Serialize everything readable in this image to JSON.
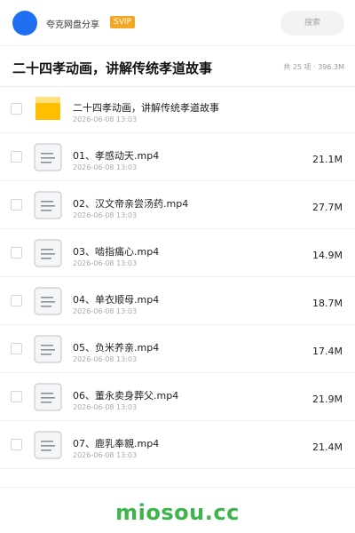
{
  "header": {
    "brand": "夸克网盘分享",
    "badge": "SVIP",
    "search_placeholder": "搜索"
  },
  "folder": {
    "title": "二十四孝动画，讲解传统孝道故事",
    "meta": "共 25 项 · 396.3M"
  },
  "items": [
    {
      "name": "二十四孝动画，讲解传统孝道故事",
      "date": "2026-06-08 13:03",
      "size": "",
      "icon": "folder-icon"
    },
    {
      "name": "01、孝感动天.mp4",
      "date": "2026-06-08 13:03",
      "size": "21.1M",
      "icon": "file-icon"
    },
    {
      "name": "02、汉文帝亲尝汤药.mp4",
      "date": "2026-06-08 13:03",
      "size": "27.7M",
      "icon": "file-icon"
    },
    {
      "name": "03、啮指痛心.mp4",
      "date": "2026-06-08 13:03",
      "size": "14.9M",
      "icon": "file-icon"
    },
    {
      "name": "04、单衣顺母.mp4",
      "date": "2026-06-08 13:03",
      "size": "18.7M",
      "icon": "file-icon"
    },
    {
      "name": "05、负米养亲.mp4",
      "date": "2026-06-08 13:03",
      "size": "17.4M",
      "icon": "file-icon"
    },
    {
      "name": "06、董永卖身葬父.mp4",
      "date": "2026-06-08 13:03",
      "size": "21.9M",
      "icon": "file-icon"
    },
    {
      "name": "07、鹿乳奉親.mp4",
      "date": "2026-06-08 13:03",
      "size": "21.4M",
      "icon": "file-icon"
    }
  ],
  "watermark": "miosou.cc",
  "colors": {
    "avatar": "#1e6ff2",
    "badge": "#f5a623",
    "folder": "#ffc107",
    "watermark": "#3cb54a"
  }
}
